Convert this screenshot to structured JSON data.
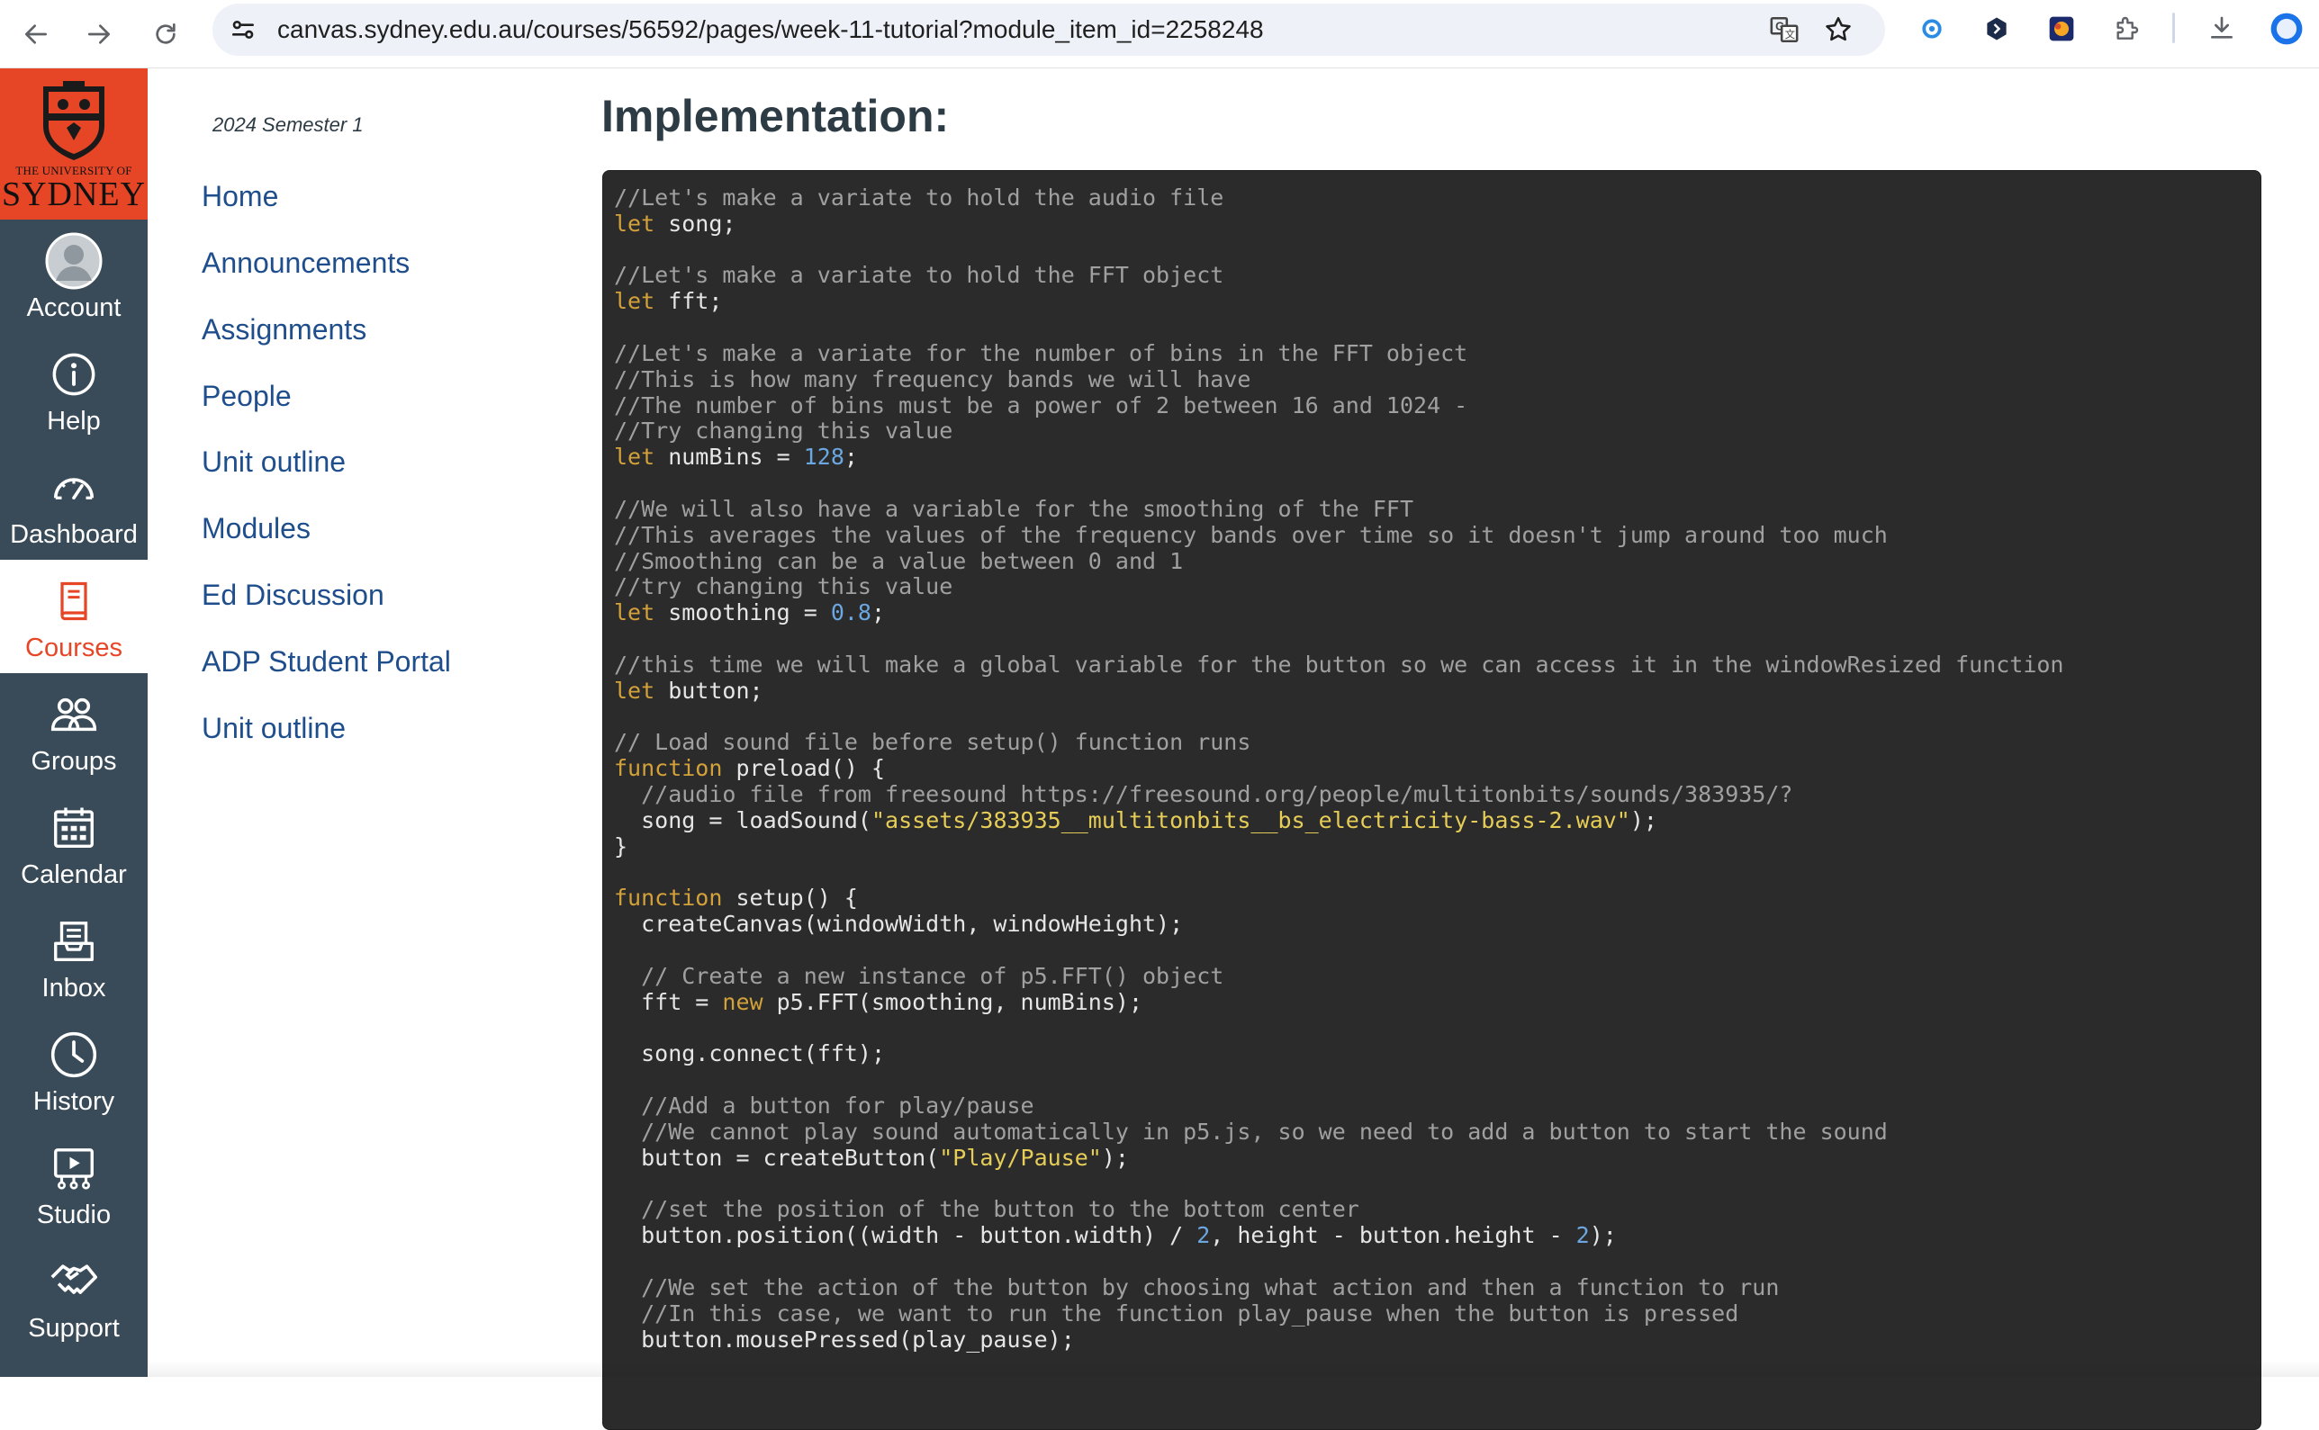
{
  "browser": {
    "url": "canvas.sydney.edu.au/courses/56592/pages/week-11-tutorial?module_item_id=2258248",
    "back_icon": "back-arrow-icon",
    "forward_icon": "forward-arrow-icon",
    "reload_icon": "reload-icon",
    "site_info_icon": "site-info-icon",
    "translate_icon": "translate-icon",
    "bookmark_icon": "star-icon",
    "extensions": [
      "extension-1-icon",
      "extension-2-icon",
      "extension-3-icon",
      "puzzle-extensions-icon"
    ],
    "download_icon": "download-icon",
    "profile_icon": "profile-icon"
  },
  "brand": {
    "logo_line1": "THE UNIVERSITY OF",
    "logo_line2": "SYDNEY",
    "color": "#e64626"
  },
  "global_nav": [
    {
      "label": "Account",
      "icon": "account-avatar-icon"
    },
    {
      "label": "Help",
      "icon": "help-icon"
    },
    {
      "label": "Dashboard",
      "icon": "dashboard-icon"
    },
    {
      "label": "Courses",
      "icon": "courses-icon",
      "active": true
    },
    {
      "label": "Groups",
      "icon": "groups-icon"
    },
    {
      "label": "Calendar",
      "icon": "calendar-icon"
    },
    {
      "label": "Inbox",
      "icon": "inbox-icon"
    },
    {
      "label": "History",
      "icon": "history-icon"
    },
    {
      "label": "Studio",
      "icon": "studio-icon"
    },
    {
      "label": "Support",
      "icon": "support-icon"
    }
  ],
  "course_nav": {
    "term": "2024 Semester 1",
    "items": [
      "Home",
      "Announcements",
      "Assignments",
      "People",
      "Unit outline",
      "Modules",
      "Ed Discussion",
      "ADP Student Portal",
      "Unit outline"
    ]
  },
  "content": {
    "heading": "Implementation:",
    "code_lines": [
      [
        [
          "c",
          "//Let's make a variate to hold the audio file"
        ]
      ],
      [
        [
          "k",
          "let"
        ],
        [
          "p",
          " song;"
        ]
      ],
      [],
      [
        [
          "c",
          "//Let's make a variate to hold the FFT object"
        ]
      ],
      [
        [
          "k",
          "let"
        ],
        [
          "p",
          " fft;"
        ]
      ],
      [],
      [
        [
          "c",
          "//Let's make a variate for the number of bins in the FFT object"
        ]
      ],
      [
        [
          "c",
          "//This is how many frequency bands we will have"
        ]
      ],
      [
        [
          "c",
          "//The number of bins must be a power of 2 between 16 and 1024 -"
        ]
      ],
      [
        [
          "c",
          "//Try changing this value"
        ]
      ],
      [
        [
          "k",
          "let"
        ],
        [
          "p",
          " numBins = "
        ],
        [
          "n",
          "128"
        ],
        [
          "p",
          ";"
        ]
      ],
      [],
      [
        [
          "c",
          "//We will also have a variable for the smoothing of the FFT"
        ]
      ],
      [
        [
          "c",
          "//This averages the values of the frequency bands over time so it doesn't jump around too much"
        ]
      ],
      [
        [
          "c",
          "//Smoothing can be a value between 0 and 1"
        ]
      ],
      [
        [
          "c",
          "//try changing this value"
        ]
      ],
      [
        [
          "k",
          "let"
        ],
        [
          "p",
          " smoothing = "
        ],
        [
          "n",
          "0.8"
        ],
        [
          "p",
          ";"
        ]
      ],
      [],
      [
        [
          "c",
          "//this time we will make a global variable for the button so we can access it in the windowResized function"
        ]
      ],
      [
        [
          "k",
          "let"
        ],
        [
          "p",
          " button;"
        ]
      ],
      [],
      [
        [
          "c",
          "// Load sound file before setup() function runs"
        ]
      ],
      [
        [
          "k",
          "function"
        ],
        [
          "p",
          " preload() {"
        ]
      ],
      [
        [
          "c",
          "  //audio file from freesound https://freesound.org/people/multitonbits/sounds/383935/?"
        ]
      ],
      [
        [
          "p",
          "  song = loadSound("
        ],
        [
          "s",
          "\"assets/383935__multitonbits__bs_electricity-bass-2.wav\""
        ],
        [
          "p",
          ");"
        ]
      ],
      [
        [
          "p",
          "}"
        ]
      ],
      [],
      [
        [
          "k",
          "function"
        ],
        [
          "p",
          " setup() {"
        ]
      ],
      [
        [
          "p",
          "  createCanvas(windowWidth, windowHeight);"
        ]
      ],
      [],
      [
        [
          "c",
          "  // Create a new instance of p5.FFT() object"
        ]
      ],
      [
        [
          "p",
          "  fft = "
        ],
        [
          "k",
          "new"
        ],
        [
          "p",
          " p5.FFT(smoothing, numBins);"
        ]
      ],
      [],
      [
        [
          "p",
          "  song.connect(fft);"
        ]
      ],
      [],
      [
        [
          "c",
          "  //Add a button for play/pause"
        ]
      ],
      [
        [
          "c",
          "  //We cannot play sound automatically in p5.js, so we need to add a button to start the sound"
        ]
      ],
      [
        [
          "p",
          "  button = createButton("
        ],
        [
          "s",
          "\"Play/Pause\""
        ],
        [
          "p",
          ");"
        ]
      ],
      [],
      [
        [
          "c",
          "  //set the position of the button to the bottom center"
        ]
      ],
      [
        [
          "p",
          "  button.position((width - button.width) / "
        ],
        [
          "n",
          "2"
        ],
        [
          "p",
          ", height - button.height - "
        ],
        [
          "n",
          "2"
        ],
        [
          "p",
          ");"
        ]
      ],
      [],
      [
        [
          "c",
          "  //We set the action of the button by choosing what action and then a function to run"
        ]
      ],
      [
        [
          "c",
          "  //In this case, we want to run the function play_pause when the button is pressed"
        ]
      ],
      [
        [
          "p",
          "  button.mousePressed(play_pause);"
        ]
      ]
    ]
  }
}
